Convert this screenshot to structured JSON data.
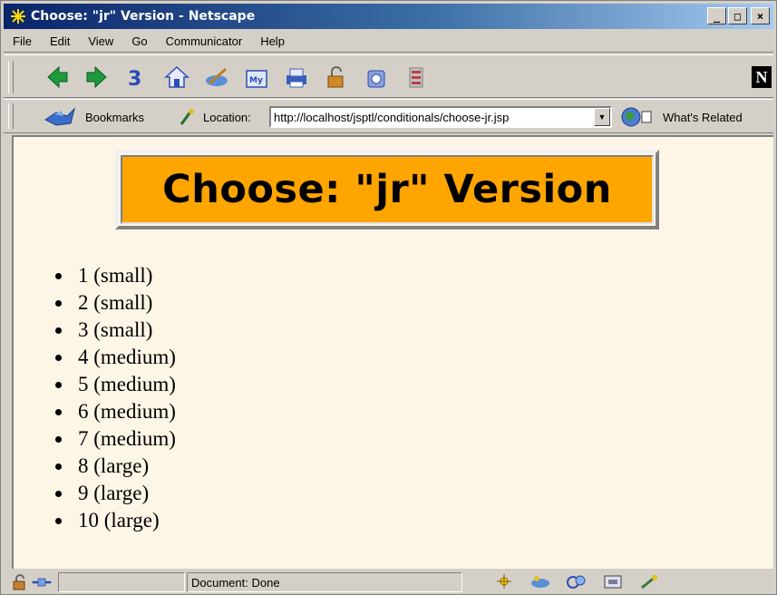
{
  "window": {
    "title": "Choose: \"jr\" Version - Netscape",
    "minimize_label": "_",
    "maximize_label": "□",
    "close_label": "×"
  },
  "menu": [
    "File",
    "Edit",
    "View",
    "Go",
    "Communicator",
    "Help"
  ],
  "toolbar": {
    "icons": [
      "back-icon",
      "forward-icon",
      "reload-icon",
      "home-icon",
      "search-icon",
      "my-netscape-icon",
      "print-icon",
      "security-icon",
      "shop-icon",
      "stop-icon"
    ],
    "brand_logo": "N"
  },
  "location_bar": {
    "bookmarks_label": "Bookmarks",
    "location_label": "Location:",
    "url": "http://localhost/jsptl/conditionals/choose-jr.jsp",
    "whats_related_label": "What's Related"
  },
  "content": {
    "heading": "Choose: \"jr\" Version",
    "items": [
      "1 (small)",
      "2 (small)",
      "3 (small)",
      "4 (medium)",
      "5 (medium)",
      "6 (medium)",
      "7 (medium)",
      "8 (large)",
      "9 (large)",
      "10 (large)"
    ],
    "background_color": "#fdf5e6",
    "heading_color": "#ffa500"
  },
  "status": {
    "text": "Document: Done"
  }
}
